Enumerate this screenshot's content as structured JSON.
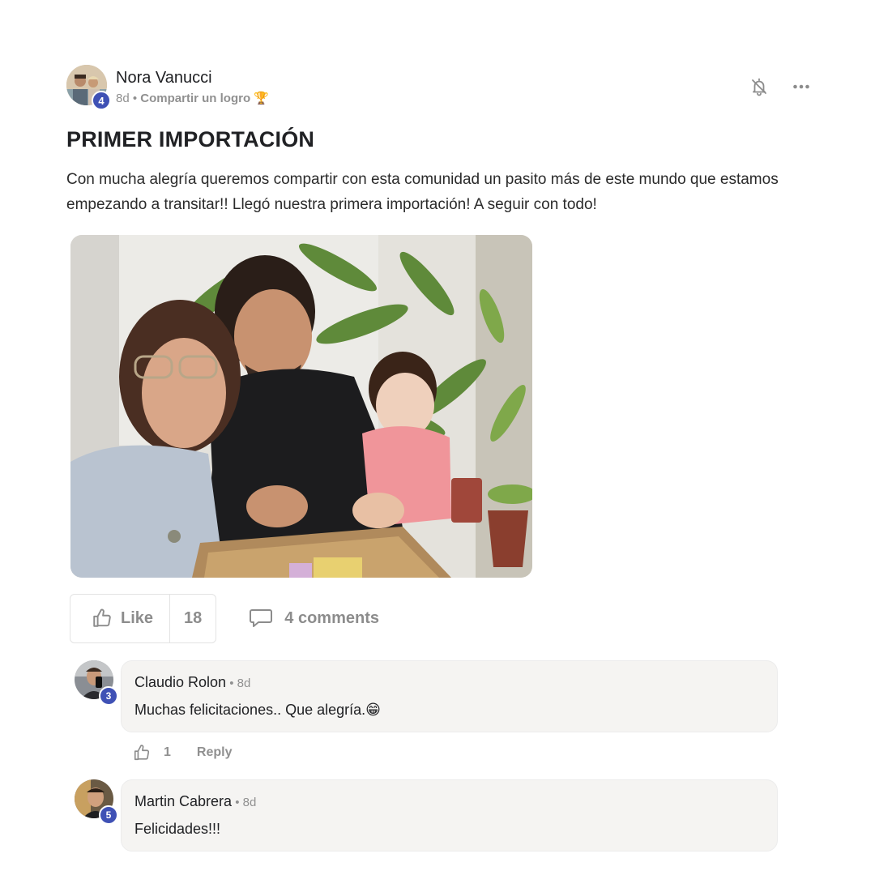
{
  "post": {
    "author": {
      "name": "Nora Vanucci",
      "level": "4"
    },
    "age": "8d",
    "meta_separator": " • ",
    "category": "Compartir un logro",
    "category_emoji": "🏆",
    "title": "PRIMER IMPORTACIÓN",
    "body": "Con mucha alegría queremos compartir con esta comunidad un pasito más de este mundo que estamos empezando a transitar!! Llegó nuestra primera importación! A seguir con todo!",
    "like_label": "Like",
    "like_count": "18",
    "comments_label": "4 comments"
  },
  "comments": [
    {
      "author": "Claudio Rolon",
      "level": "3",
      "time": " • 8d",
      "text": "Muchas felicitaciones.. Que alegría.",
      "emoji": "😁",
      "like_count": "1",
      "reply_label": "Reply"
    },
    {
      "author": "Martin Cabrera",
      "level": "5",
      "time": " • 8d",
      "text": "Felicidades!!!"
    }
  ],
  "icons": {
    "bell": "bell-off-icon",
    "more": "more-horizontal-icon",
    "like": "thumbs-up-icon",
    "comment": "comment-bubble-icon"
  },
  "colors": {
    "level_badge": "#3f51b5",
    "muted_text": "#909090",
    "comment_bubble": "#f5f4f2"
  }
}
